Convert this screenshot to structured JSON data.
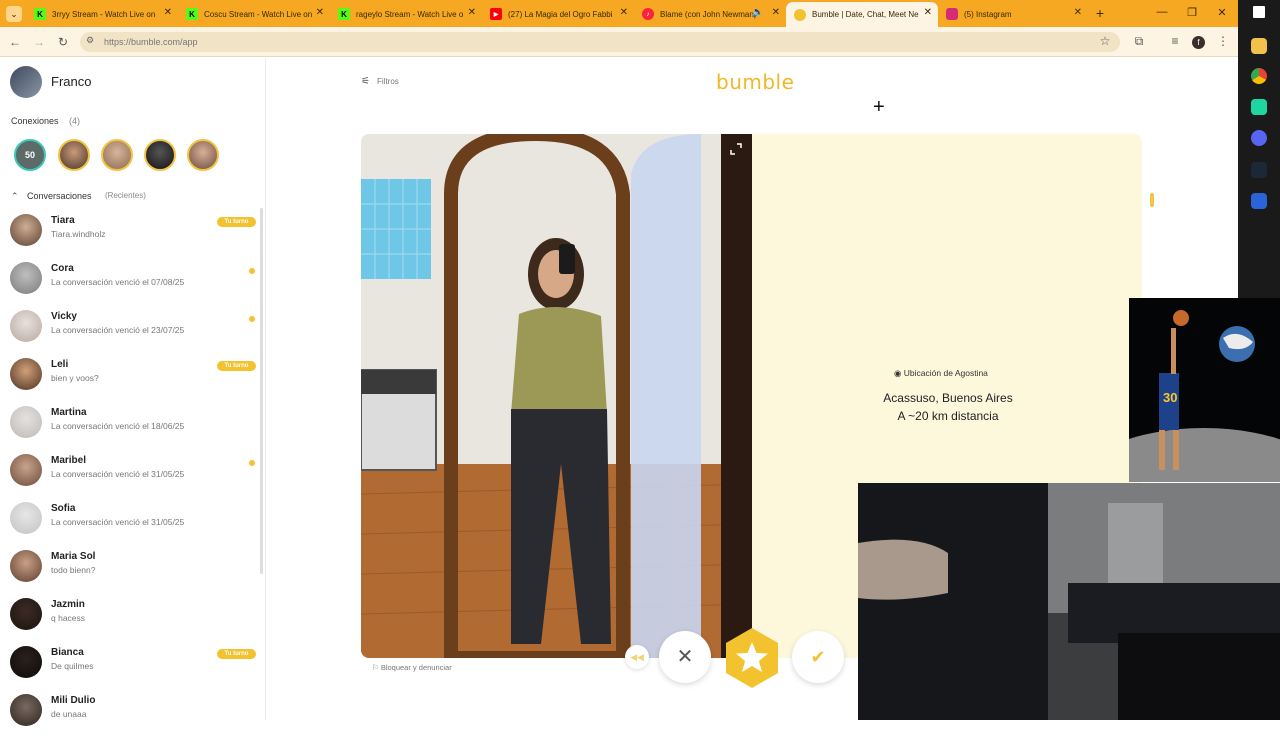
{
  "browser": {
    "tabs": [
      {
        "title": "3rryy Stream - Watch Live on",
        "favicon": "kick-icon",
        "color": "#53fc18"
      },
      {
        "title": "Coscu Stream - Watch Live on",
        "favicon": "kick-icon",
        "color": "#53fc18"
      },
      {
        "title": "rageylo Stream - Watch Live o",
        "favicon": "kick-icon",
        "color": "#53fc18"
      },
      {
        "title": "(27) La Magia del Ogro Fabbi",
        "favicon": "youtube-icon",
        "color": "#ff0000"
      },
      {
        "title": "Blame (con John Newman)",
        "favicon": "music-icon",
        "color": "#fa233b"
      },
      {
        "title": "Bumble | Date, Chat, Meet Ne",
        "favicon": "bumble-icon",
        "color": "#f3c22f"
      },
      {
        "title": "(5) Instagram",
        "favicon": "instagram-icon",
        "color": "#d62976"
      }
    ],
    "url": "https://bumble.com/app",
    "accent": "#f6a823",
    "profile_initial": "f"
  },
  "sidebar": {
    "user_name": "Franco",
    "connections_label": "Conexiones",
    "connections_count": "(4)",
    "connections_first_badge": "50",
    "conversations_label": "Conversaciones",
    "conversations_sub": "(Recientes)",
    "conversations": [
      {
        "name": "Tiara",
        "message": "Tiara.windholz",
        "badge": "Tu turno",
        "dot": false
      },
      {
        "name": "Cora",
        "message": "La conversación venció el 07/08/25",
        "badge": "",
        "dot": true
      },
      {
        "name": "Vicky",
        "message": "La conversación venció el 23/07/25",
        "badge": "",
        "dot": true
      },
      {
        "name": "Leli",
        "message": "bien y voos?",
        "badge": "Tu turno",
        "dot": false
      },
      {
        "name": "Martina",
        "message": "La conversación venció el 18/06/25",
        "badge": "",
        "dot": false
      },
      {
        "name": "Maribel",
        "message": "La conversación venció el 31/05/25",
        "badge": "",
        "dot": true
      },
      {
        "name": "Sofia",
        "message": "La conversación venció el 31/05/25",
        "badge": "",
        "dot": false
      },
      {
        "name": "Maria Sol",
        "message": "todo bienn?",
        "badge": "",
        "dot": false
      },
      {
        "name": "Jazmin",
        "message": "q hacess",
        "badge": "",
        "dot": false
      },
      {
        "name": "Bianca",
        "message": "De quilmes",
        "badge": "Tu turno",
        "dot": false
      },
      {
        "name": "Mili Dulio",
        "message": "de unaaa",
        "badge": "",
        "dot": false
      }
    ]
  },
  "main": {
    "filters_label": "Filtros",
    "logo": "bumble",
    "location_label": "Ubicación de Agostina",
    "location_city": "Acassuso, Buenos Aires",
    "location_distance": "A ~20 km distancia",
    "report_label": "Bloquear y denunciar"
  },
  "overlay": {
    "jersey_number": "30"
  },
  "colors": {
    "bumble_yellow": "#f3c22f",
    "info_bg": "#fdf7dc"
  }
}
